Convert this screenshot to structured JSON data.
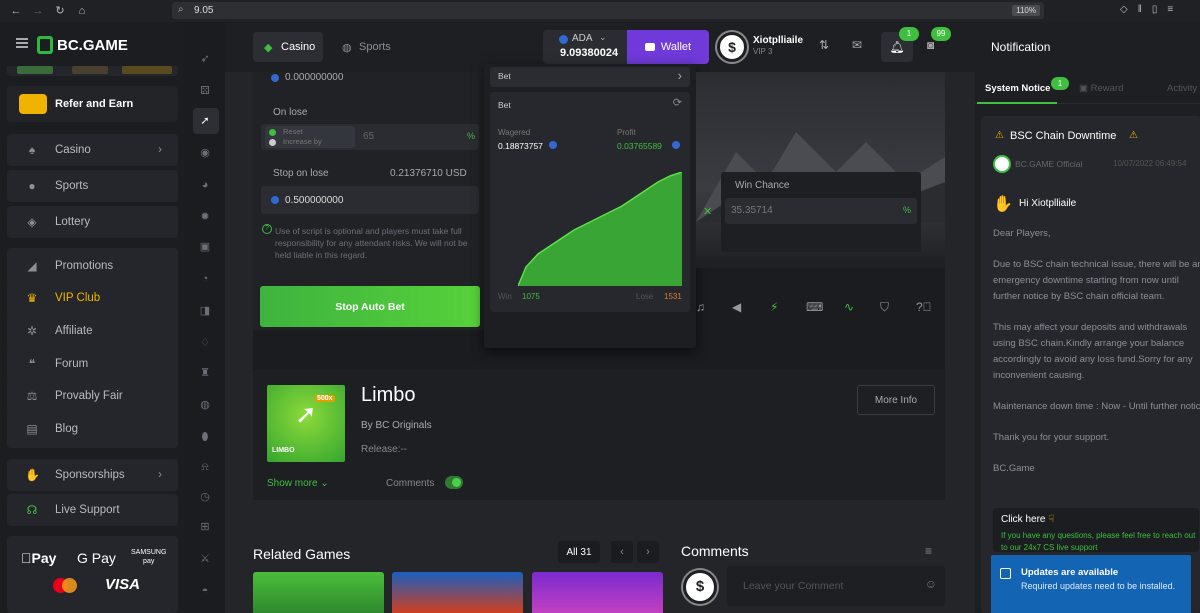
{
  "browser": {
    "url": "9.05",
    "zoom": "110%"
  },
  "brand": {
    "name": "BC.GAME"
  },
  "sidebar": {
    "refer": "Refer and Earn",
    "items": [
      {
        "label": "Casino",
        "icon": "spade-icon",
        "has_arrow": true
      },
      {
        "label": "Sports",
        "icon": "ball-icon"
      },
      {
        "label": "Lottery",
        "icon": "ticket-icon"
      },
      {
        "label": "Promotions",
        "icon": "megaphone-icon"
      },
      {
        "label": "VIP Club",
        "icon": "crown-icon"
      },
      {
        "label": "Affiliate",
        "icon": "network-icon"
      },
      {
        "label": "Forum",
        "icon": "chat-icon"
      },
      {
        "label": "Provably Fair",
        "icon": "scale-icon"
      },
      {
        "label": "Blog",
        "icon": "document-icon"
      },
      {
        "label": "Sponsorships",
        "icon": "handshake-icon"
      },
      {
        "label": "Live Support",
        "icon": "headset-icon"
      }
    ],
    "payments": [
      "Pay",
      "G Pay",
      "SAMSUNG\npay",
      "VISA"
    ]
  },
  "topbar": {
    "casino_tab": "Casino",
    "sports_tab": "Sports",
    "currency": "ADA",
    "balance": "9.09380024",
    "wallet": "Wallet",
    "username": "Xiotplliaile",
    "vip": "VIP 3",
    "notif_count": "1",
    "chat_count": "99"
  },
  "game": {
    "on_lose_amount": "0.000000000",
    "on_lose_label": "On lose",
    "reset_label": "Reset",
    "increase_label": "Increase by",
    "increase_value": "65",
    "percent": "%",
    "stop_on_lose_label": "Stop on lose",
    "stop_on_lose_usd": "0.21376710 USD",
    "stop_on_lose_value": "0.500000000",
    "disclaimer": "Use of script is optional and players must take full responsibility for any attendant risks. We will not be held liable in this regard.",
    "stop_button": "Stop Auto Bet",
    "bet_tab_label": "Bet",
    "stats_title": "Bet",
    "wagered_label": "Wagered",
    "wagered": "0.18873757",
    "profit_label": "Profit",
    "profit": "0.03765589",
    "win_label": "Win",
    "win_count": "1075",
    "lose_label": "Lose",
    "lose_count": "1531",
    "win_chance_label": "Win Chance",
    "win_chance": "35.35714",
    "chance_pct": "%"
  },
  "game_info": {
    "title": "Limbo",
    "by": "By BC Originals",
    "release": "Release:--",
    "more_info": "More Info",
    "show_more": "Show more",
    "comments": "Comments",
    "thumb_label": "LIMBO",
    "thumb_badge": "500x"
  },
  "related": {
    "title": "Related Games",
    "all": "All 31",
    "comments_title": "Comments",
    "comment_placeholder": "Leave your Comment"
  },
  "notification": {
    "title": "Notification",
    "tabs": [
      "System Notice",
      "Reward",
      "Activity"
    ],
    "tab_badge": "1",
    "headline": "BSC Chain Downtime",
    "sender": "BC.GAME Official",
    "time": "10/07/2022 06:49:54",
    "greeting": "Hi Xiotplliaile",
    "body": [
      "Dear Players,",
      "Due to BSC chain technical issue, there will be an emergency downtime starting from now until further notice by BSC chain official team.",
      "This may affect your deposits and withdrawals using BSC chain.Kindly arrange your balance accordingly to avoid any loss fund.Sorry for any inconvenient causing.",
      "Maintenance down time : Now - Until further notice",
      "Thank you for your support.",
      "BC.Game"
    ],
    "click_here": "Click here",
    "question": "If you have any questions, please feel free to reach out to our 24x7 CS live support"
  },
  "toast": {
    "title": "Updates are available",
    "body": "Required updates need to be installed."
  },
  "colors": {
    "accent_green": "#3fbf3f",
    "wallet_purple": "#6f3ad9",
    "bg": "#232529"
  }
}
